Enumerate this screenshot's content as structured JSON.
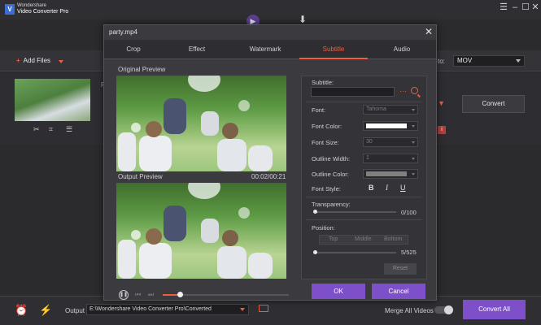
{
  "app": {
    "brand_line1": "Wondershare",
    "brand_line2": "Video Converter Pro",
    "logo_letter": "V"
  },
  "toolbar": {
    "add_files_label": "Add Files",
    "convert_to_label": "to:",
    "format_value": "MOV"
  },
  "file_row": {
    "convert_label": "Convert"
  },
  "bottom_bar": {
    "output_label": "Output",
    "output_path": "E:\\Wondershare Video Converter Pro\\Converted",
    "merge_label": "Merge All Videos",
    "convert_all_label": "Convert All"
  },
  "dialog": {
    "title": "party.mp4",
    "tabs": [
      {
        "label": "Crop"
      },
      {
        "label": "Effect"
      },
      {
        "label": "Watermark"
      },
      {
        "label": "Subtitle"
      },
      {
        "label": "Audio"
      }
    ],
    "active_tab": "Subtitle",
    "original_preview_label": "Original Preview",
    "output_preview_label": "Output Preview",
    "time_readout": "00:02/00:21",
    "subtitle": {
      "subtitle_label": "Subtitle:",
      "subtitle_value": "",
      "font_label": "Font:",
      "font_value": "Tahoma",
      "font_color_label": "Font Color:",
      "font_color": "#ffffff",
      "font_size_label": "Font Size:",
      "font_size_value": "30",
      "outline_width_label": "Outline Width:",
      "outline_width_value": "1",
      "outline_color_label": "Outline Color:",
      "outline_color": "#808080",
      "font_style_label": "Font Style:",
      "style_bold": "B",
      "style_italic": "I",
      "style_underline": "U",
      "transparency_label": "Transparency:",
      "transparency_readout": "0/100",
      "position_label": "Position:",
      "position_options": [
        "Top",
        "Middle",
        "Bottom"
      ],
      "position_readout": "5/525",
      "reset_label": "Reset"
    },
    "ok_label": "OK",
    "cancel_label": "Cancel"
  },
  "colors": {
    "accent_orange": "#f25c3e",
    "accent_purple": "#7d4fc9",
    "background": "#2b2b2e"
  }
}
